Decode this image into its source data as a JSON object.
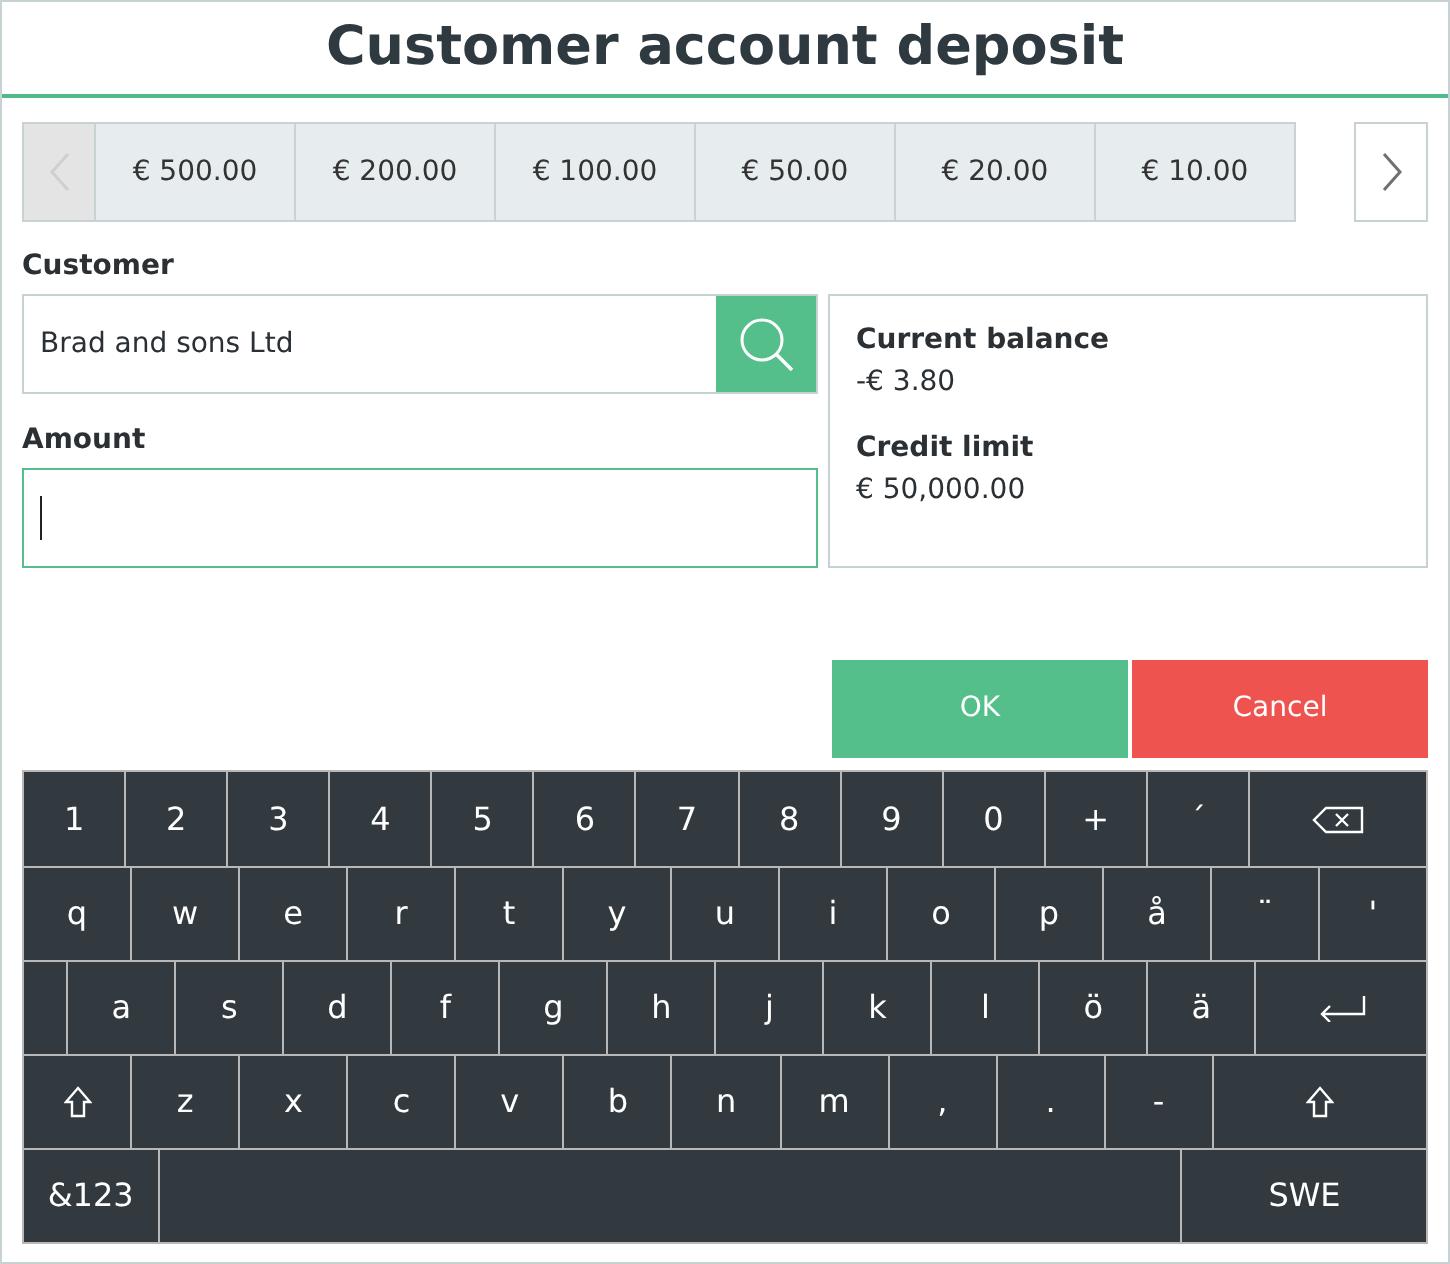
{
  "window": {
    "title": "Customer account deposit"
  },
  "presets": {
    "prev": {
      "disabled": true
    },
    "next": {
      "disabled": false
    },
    "items": [
      {
        "label": "€ 500.00"
      },
      {
        "label": "€ 200.00"
      },
      {
        "label": "€ 100.00"
      },
      {
        "label": "€ 50.00"
      },
      {
        "label": "€ 20.00"
      },
      {
        "label": "€ 10.00"
      }
    ]
  },
  "customer": {
    "label": "Customer",
    "value": "Brad and sons Ltd"
  },
  "amount": {
    "label": "Amount"
  },
  "info": [
    {
      "label": "Current balance",
      "value": "-€ 3.80"
    },
    {
      "label": "Credit limit",
      "value": "€ 50,000.00"
    }
  ],
  "buttons": [
    {
      "kind": "ok",
      "label": "OK"
    },
    {
      "kind": "cancel",
      "label": "Cancel"
    }
  ],
  "keyboard": [
    [
      {
        "kind": "char",
        "label": "1"
      },
      {
        "kind": "char",
        "label": "2"
      },
      {
        "kind": "char",
        "label": "3"
      },
      {
        "kind": "char",
        "label": "4"
      },
      {
        "kind": "char",
        "label": "5"
      },
      {
        "kind": "char",
        "label": "6"
      },
      {
        "kind": "char",
        "label": "7"
      },
      {
        "kind": "char",
        "label": "8"
      },
      {
        "kind": "char",
        "label": "9"
      },
      {
        "kind": "char",
        "label": "0"
      },
      {
        "kind": "char",
        "label": "+"
      },
      {
        "kind": "char",
        "label": "´"
      },
      {
        "kind": "backspace"
      }
    ],
    [
      {
        "kind": "char",
        "label": "q"
      },
      {
        "kind": "char",
        "label": "w"
      },
      {
        "kind": "char",
        "label": "e"
      },
      {
        "kind": "char",
        "label": "r"
      },
      {
        "kind": "char",
        "label": "t"
      },
      {
        "kind": "char",
        "label": "y"
      },
      {
        "kind": "char",
        "label": "u"
      },
      {
        "kind": "char",
        "label": "i"
      },
      {
        "kind": "char",
        "label": "o"
      },
      {
        "kind": "char",
        "label": "p"
      },
      {
        "kind": "char",
        "label": "å"
      },
      {
        "kind": "char",
        "label": "¨"
      },
      {
        "kind": "char",
        "label": "'"
      }
    ],
    [
      {
        "kind": "blank"
      },
      {
        "kind": "char",
        "label": "a"
      },
      {
        "kind": "char",
        "label": "s"
      },
      {
        "kind": "char",
        "label": "d"
      },
      {
        "kind": "char",
        "label": "f"
      },
      {
        "kind": "char",
        "label": "g"
      },
      {
        "kind": "char",
        "label": "h"
      },
      {
        "kind": "char",
        "label": "j"
      },
      {
        "kind": "char",
        "label": "k"
      },
      {
        "kind": "char",
        "label": "l"
      },
      {
        "kind": "char",
        "label": "ö"
      },
      {
        "kind": "char",
        "label": "ä"
      },
      {
        "kind": "enter"
      }
    ],
    [
      {
        "kind": "shift"
      },
      {
        "kind": "char",
        "label": "z"
      },
      {
        "kind": "char",
        "label": "x"
      },
      {
        "kind": "char",
        "label": "c"
      },
      {
        "kind": "char",
        "label": "v"
      },
      {
        "kind": "char",
        "label": "b"
      },
      {
        "kind": "char",
        "label": "n"
      },
      {
        "kind": "char",
        "label": "m"
      },
      {
        "kind": "char",
        "label": ","
      },
      {
        "kind": "char",
        "label": "."
      },
      {
        "kind": "char",
        "label": "-"
      },
      {
        "kind": "shift"
      }
    ],
    [
      {
        "kind": "mode",
        "label": "&123"
      },
      {
        "kind": "space"
      },
      {
        "kind": "lang",
        "label": "SWE"
      }
    ]
  ]
}
